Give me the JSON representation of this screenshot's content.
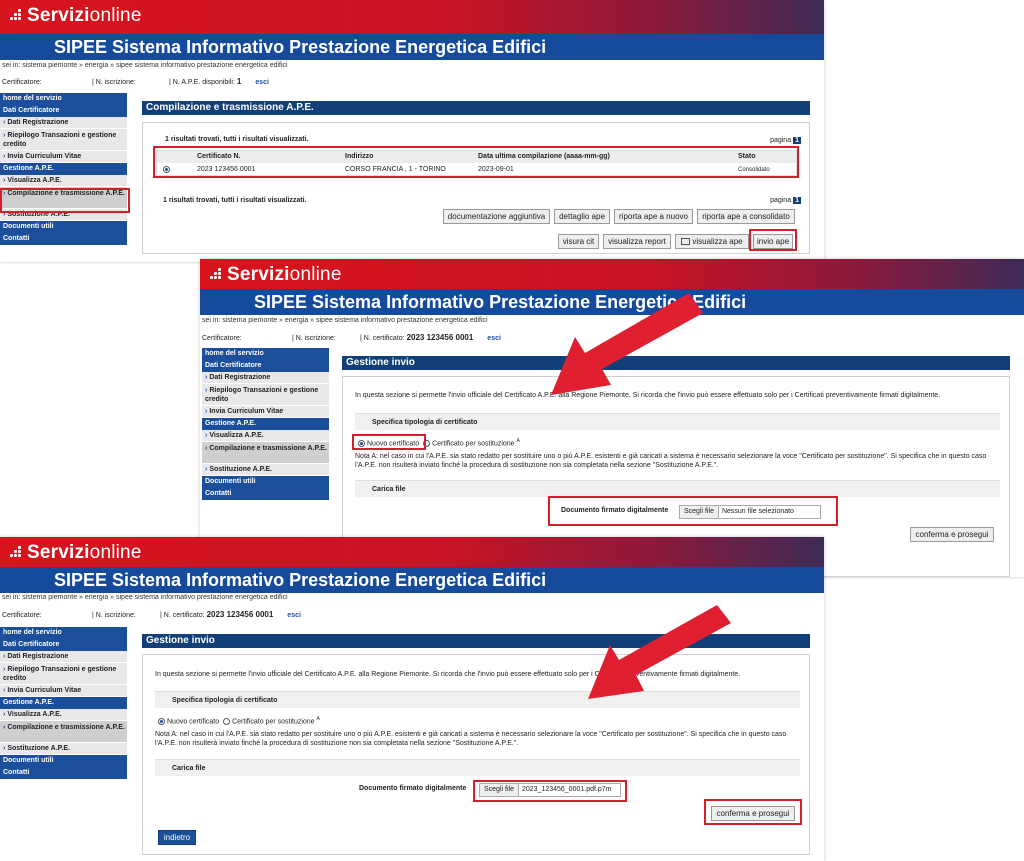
{
  "brand": {
    "word_bold": "Servizi",
    "word_thin": "online"
  },
  "app_title": "SIPEE Sistema Informativo Prestazione Energetica Edifici",
  "breadcrumb": "sei in: sistema piemonte » energia » sipee sistema informativo prestazione energetica edifici",
  "colors": {
    "brand_red": "#d8141c",
    "title_blue": "#154b9a",
    "section_blue": "#123f77",
    "highlight_red": "#d81e2a"
  },
  "sidebar": {
    "home": "home del servizio",
    "dati_cert": "Dati Certificatore",
    "dati_reg": "Dati Registrazione",
    "riepilogo": "Riepilogo Transazioni e gestione credito",
    "curriculum": "Invia Curriculum Vitae",
    "gestione_ape": "Gestione A.P.E.",
    "visualizza": "Visualizza A.P.E.",
    "compilazione": "Compilazione e trasmissione A.P.E.",
    "sostituzione": "Sostituzione A.P.E.",
    "documenti": "Documenti utili",
    "contatti": "Contatti"
  },
  "shot1": {
    "info": {
      "certificatore": "Certificatore:",
      "iscrizione": "| N. iscrizione:",
      "ape_disp": "| N. A.P.E. disponibili:",
      "ape_count": "1",
      "esci": "esci"
    },
    "section_title": "Compilazione e trasmissione A.P.E.",
    "results_text": "1 risultati trovati, tutti i risultati visualizzati.",
    "pagina": "pagina",
    "page_num": "1",
    "table": {
      "headers": [
        "Certificato N.",
        "Indirizzo",
        "Data ultima compilazione (aaaa-mm-gg)",
        "Stato"
      ],
      "row": [
        "2023 123456 0001",
        "CORSO FRANCIA , 1 - TORINO",
        "2023-09-01",
        "Consolidato"
      ]
    },
    "buttons": {
      "doc_agg": "documentazione aggiuntiva",
      "dettaglio": "dettaglio ape",
      "riporta_nuovo": "riporta ape a nuovo",
      "riporta_cons": "riporta ape a consolidato",
      "visura": "visura cit",
      "report": "visualizza report",
      "visualizza_ape": "visualizza ape",
      "invio": "invio ape"
    }
  },
  "gestione": {
    "info": {
      "certificatore": "Certificatore:",
      "iscrizione": "| N. iscrizione:",
      "cert_label": "| N. certificato:",
      "cert_num": "2023 123456 0001",
      "esci": "esci"
    },
    "section_title": "Gestione invio",
    "intro": "In questa sezione si permette l'invio ufficiale del Certificato A.P.E. alla Regione Piemonte. Si ricorda che l'invio può essere effettuato solo per i Certificati preventivamente firmati digitalmente.",
    "tipologia": "Specifica tipologia di certificato",
    "nuovo": "Nuovo certificato",
    "sostituzione": "Certificato per sostituzione",
    "sup": "A",
    "nota": "Nota A: nel caso in cui l'A.P.E. sia stato redatto per sostituire uno o più A.P.E. esistenti e già caricati a sistema è necessario selezionare la voce \"Certificato per sostituzione\". Si specifica che in questo caso l'A.P.E. non risulterà inviato finché la procedura di sostituzione non sia completata nella sezione \"Sostituzione A.P.E.\".",
    "carica": "Carica file",
    "doc_label": "Documento firmato digitalmente",
    "scegli": "Scegli file",
    "no_file": "Nessun file selezionato",
    "file_name": "2023_123456_0001.pdf.p7m",
    "conferma": "conferma e prosegui",
    "indietro": "indietro"
  }
}
